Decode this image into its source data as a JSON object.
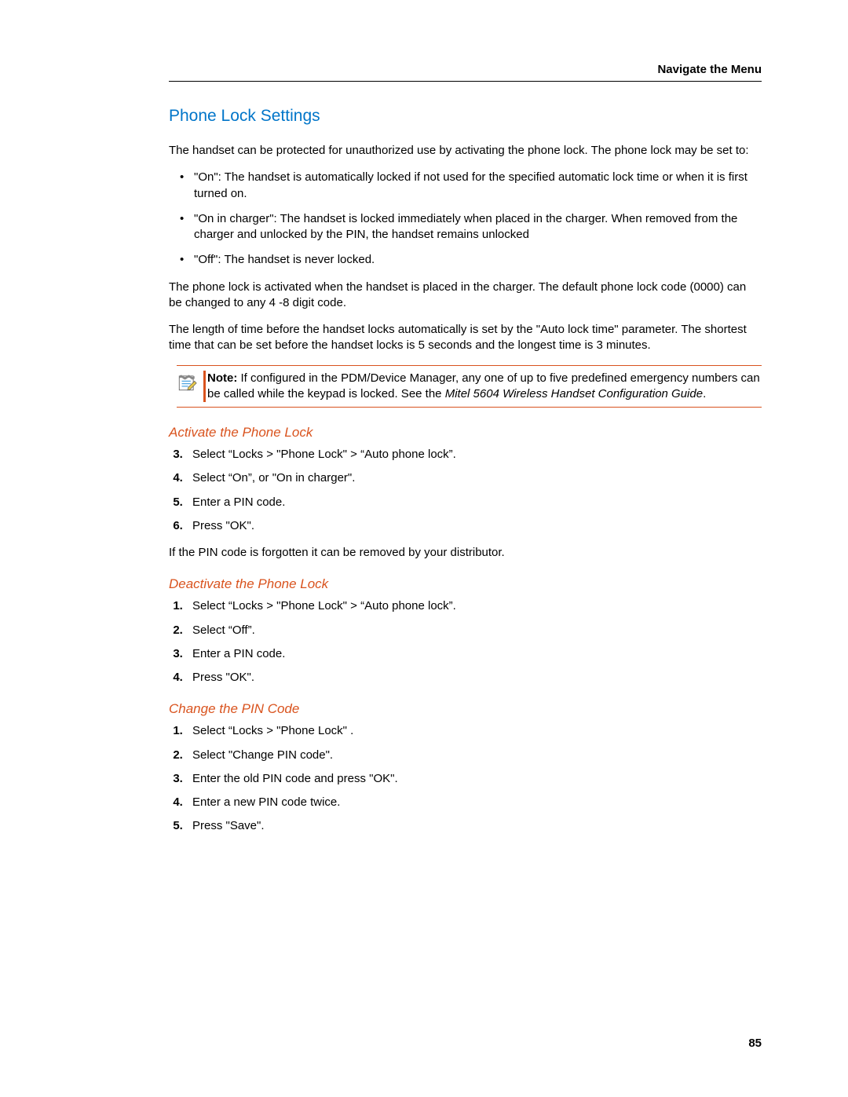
{
  "header": "Navigate the Menu",
  "title": "Phone Lock Settings",
  "intro": "The handset can be protected for unauthorized use by activating the phone lock. The phone lock may be set to:",
  "modes": [
    "\"On\": The handset is automatically locked if not used for the specified automatic lock time or when it is first turned on.",
    "\"On in charger\": The handset is locked immediately when placed in the charger. When removed from the charger and unlocked by the PIN, the handset remains unlocked",
    "\"Off\": The handset is never locked."
  ],
  "para2": "The phone lock is activated when the handset is placed in the charger. The default phone lock code (0000) can be changed to any 4 -8 digit code.",
  "para3": "The length of time before the handset locks automatically is set by the \"Auto lock time\" parameter. The shortest time that can be set before the handset locks is 5 seconds and the longest time is 3 minutes.",
  "note": {
    "label": "Note:",
    "body": " If configured in the PDM/Device Manager, any one of up to five predefined emergency numbers can be called while the keypad is locked. See the ",
    "italic": "Mitel 5604 Wireless Handset Configuration Guide",
    "tail": "."
  },
  "sections": {
    "activate": {
      "title": "Activate the Phone Lock",
      "start": 3,
      "steps": [
        "Select “Locks > \"Phone Lock\" > “Auto phone lock”.",
        "Select “On”, or \"On in charger\".",
        "Enter a PIN code.",
        "Press \"OK\"."
      ],
      "after": "If the PIN code is forgotten it can be removed by your distributor."
    },
    "deactivate": {
      "title": "Deactivate the Phone Lock",
      "start": 1,
      "steps": [
        "Select “Locks > \"Phone Lock\" > “Auto phone lock”.",
        "Select “Off”.",
        "Enter a PIN code.",
        "Press \"OK\"."
      ]
    },
    "changepin": {
      "title": "Change the PIN Code",
      "start": 1,
      "steps": [
        "Select “Locks > \"Phone Lock\" .",
        "Select \"Change PIN code\".",
        "Enter the old PIN code and press \"OK\".",
        "Enter a new PIN code twice.",
        "Press \"Save\"."
      ]
    }
  },
  "pageNumber": "85"
}
